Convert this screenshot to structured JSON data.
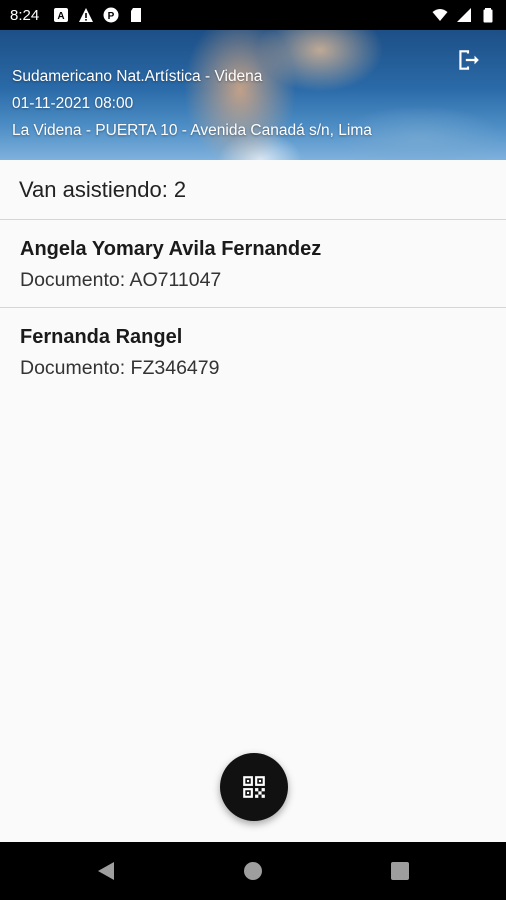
{
  "status_bar": {
    "time": "8:24",
    "left_icons": [
      "translate-icon",
      "warning-icon",
      "parking-icon",
      "sd-card-icon"
    ],
    "right_icons": [
      "wifi-icon",
      "signal-icon",
      "battery-icon"
    ]
  },
  "event": {
    "title": "Sudamericano Nat.Artística - Videna",
    "datetime": "01-11-2021 08:00",
    "location": "La Videna - PUERTA 10 - Avenida Canadá s/n, Lima"
  },
  "attendance": {
    "label": "Van asistiendo: 2"
  },
  "attendees": [
    {
      "name": "Angela Yomary Avila Fernandez",
      "document": "Documento: AO711047"
    },
    {
      "name": "Fernanda Rangel",
      "document": "Documento: FZ346479"
    }
  ],
  "colors": {
    "fab": "#111111",
    "background": "#fafafa",
    "divider": "#d6d6d6"
  },
  "icons": {
    "logout": "logout-icon",
    "fab": "qr-code-icon",
    "nav": [
      "back-icon",
      "home-icon",
      "recents-icon"
    ]
  }
}
